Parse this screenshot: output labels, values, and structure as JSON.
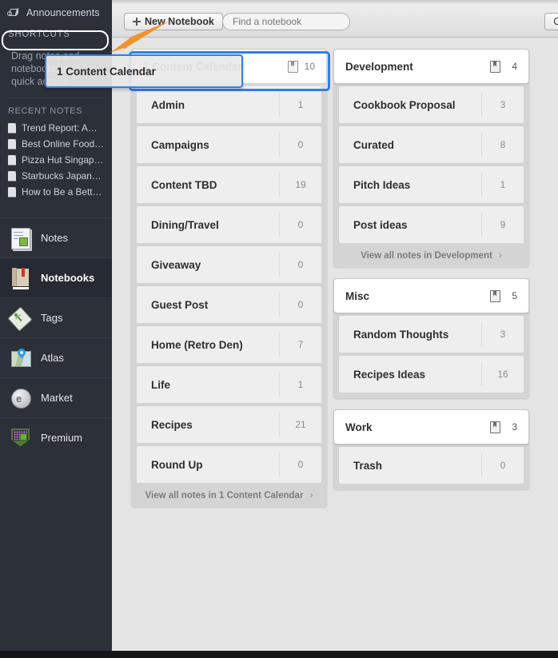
{
  "sidebar": {
    "announcements": {
      "label": "Announcements",
      "icon": "megaphone-icon"
    },
    "shortcuts_header": "SHORTCUTS",
    "shortcuts_hint": "Drag notes and notebooks here for quick access",
    "recent_header": "RECENT NOTES",
    "recent_notes": [
      {
        "label": "Trend Report: A…"
      },
      {
        "label": "Best Online Food…"
      },
      {
        "label": "Pizza Hut Singap…"
      },
      {
        "label": "Starbucks Japan…"
      },
      {
        "label": "How to Be a Bett…"
      }
    ],
    "nav": [
      {
        "label": "Notes",
        "icon": "notes-icon",
        "active": false
      },
      {
        "label": "Notebooks",
        "icon": "notebooks-icon",
        "active": true
      },
      {
        "label": "Tags",
        "icon": "tags-icon",
        "active": false
      },
      {
        "label": "Atlas",
        "icon": "atlas-icon",
        "active": false
      },
      {
        "label": "Market",
        "icon": "market-icon",
        "active": false
      },
      {
        "label": "Premium",
        "icon": "premium-icon",
        "active": false
      }
    ]
  },
  "toolbar": {
    "new_notebook_label": "New Notebook",
    "search_placeholder": "Find a notebook",
    "search_value": "",
    "right_button_label": "Ow"
  },
  "drag": {
    "ghost_label": "1 Content Calendar",
    "highlight_color": "#2f7fe8",
    "arrow_color": "#f0932b"
  },
  "columns": [
    {
      "stacks": [
        {
          "header": {
            "name": "1 Content Calendar",
            "count": "10",
            "icon": "notebook-icon"
          },
          "rows": [
            {
              "name": "Admin",
              "count": "1"
            },
            {
              "name": "Campaigns",
              "count": "0"
            },
            {
              "name": "Content TBD",
              "count": "19"
            },
            {
              "name": "Dining/Travel",
              "count": "0"
            },
            {
              "name": "Giveaway",
              "count": "0"
            },
            {
              "name": "Guest Post",
              "count": "0"
            },
            {
              "name": "Home (Retro Den)",
              "count": "7"
            },
            {
              "name": "Life",
              "count": "1"
            },
            {
              "name": "Recipes",
              "count": "21"
            },
            {
              "name": "Round Up",
              "count": "0"
            }
          ],
          "view_all": "View all notes in 1 Content Calendar",
          "chevron": "›"
        }
      ]
    },
    {
      "stacks": [
        {
          "header": {
            "name": "Development",
            "count": "4",
            "icon": "notebook-icon"
          },
          "rows": [
            {
              "name": "Cookbook Proposal",
              "count": "3"
            },
            {
              "name": "Curated",
              "count": "8"
            },
            {
              "name": "Pitch Ideas",
              "count": "1"
            },
            {
              "name": "Post ideas",
              "count": "9"
            }
          ],
          "view_all": "View all notes in Development",
          "chevron": "›"
        },
        {
          "header": {
            "name": "Misc",
            "count": "5",
            "icon": "notebook-icon"
          },
          "rows": [
            {
              "name": "Random Thoughts",
              "count": "3"
            },
            {
              "name": "Recipes Ideas",
              "count": "16"
            }
          ],
          "view_all": "",
          "chevron": ""
        },
        {
          "header": {
            "name": "Work",
            "count": "3",
            "icon": "notebook-icon"
          },
          "rows": [
            {
              "name": "Trash",
              "count": "0"
            }
          ],
          "view_all": "",
          "chevron": ""
        }
      ]
    }
  ]
}
